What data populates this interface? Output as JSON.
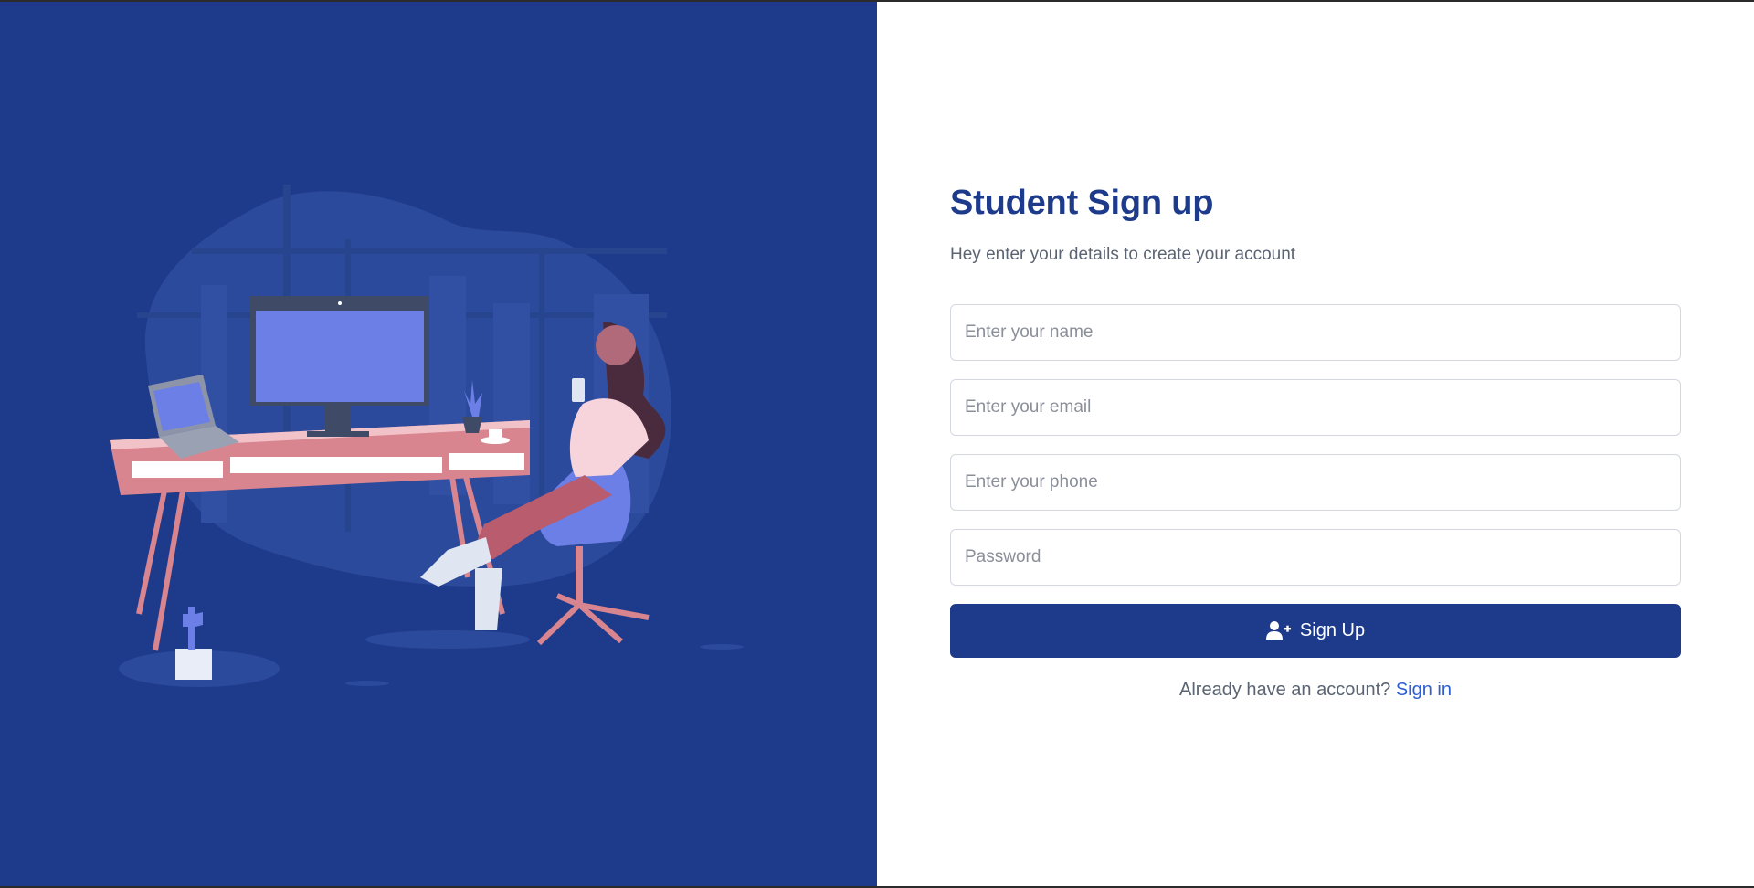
{
  "illustration": {
    "name": "person-at-desk-illustration",
    "colors": {
      "background": "#1e3a8a",
      "blob": "#2c4a9c",
      "desk": "#f1c2c7",
      "desk_legs": "#d9858f",
      "screen": "#6b7fe6",
      "monitor_frame": "#3f4a66",
      "chair": "#6b7fe6"
    }
  },
  "form": {
    "title": "Student Sign up",
    "subtitle": "Hey enter your details to create your account",
    "fields": {
      "name_placeholder": "Enter your name",
      "email_placeholder": "Enter your email",
      "phone_placeholder": "Enter your phone",
      "password_placeholder": "Password"
    },
    "submit": {
      "label": "Sign Up",
      "icon": "user-plus-icon"
    },
    "footer": {
      "prompt": "Already have an account?",
      "link_label": "Sign in"
    }
  },
  "theme": {
    "primary": "#1e3a8a",
    "link": "#2c5fd1",
    "muted_text": "#5b6472"
  }
}
